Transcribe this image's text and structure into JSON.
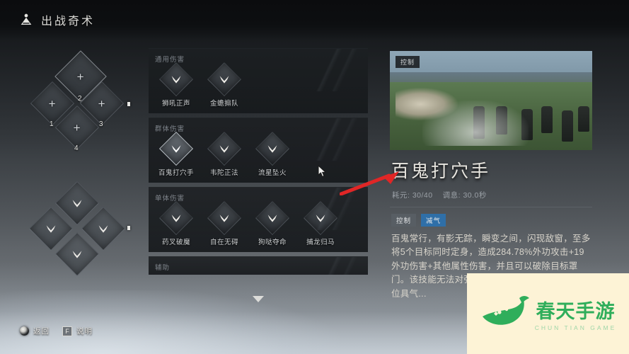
{
  "header": {
    "icon": "meditate-icon",
    "title": "出战奇术"
  },
  "equip": {
    "clusters": [
      {
        "name": "empty-slots",
        "slots": [
          {
            "icon": "plus-icon",
            "num": "2",
            "state": "empty",
            "selected": true
          },
          {
            "icon": "plus-icon",
            "num": "1",
            "state": "empty",
            "selected": false
          },
          {
            "icon": "plus-icon",
            "num": "3",
            "state": "empty",
            "selected": false
          },
          {
            "icon": "plus-icon",
            "num": "4",
            "state": "empty",
            "selected": false
          }
        ]
      },
      {
        "name": "equipped-slots",
        "slots": [
          {
            "icon": "fist-icon",
            "num": "",
            "state": "filled",
            "selected": false
          },
          {
            "icon": "fist-icon",
            "num": "",
            "state": "filled",
            "selected": false
          },
          {
            "icon": "fist-icon",
            "num": "",
            "state": "filled",
            "selected": false
          },
          {
            "icon": "fist-icon",
            "num": "",
            "state": "filled",
            "selected": false
          }
        ]
      }
    ]
  },
  "list": {
    "categories": [
      {
        "title": "通用伤害",
        "items": [
          {
            "label": "狮吼正声",
            "icon": "fist-icon",
            "selected": false
          },
          {
            "label": "金蟾搧队",
            "icon": "fist-icon",
            "selected": false
          }
        ]
      },
      {
        "title": "群体伤害",
        "items": [
          {
            "label": "百鬼打穴手",
            "icon": "fist-icon",
            "selected": true
          },
          {
            "label": "韦陀正法",
            "icon": "fist-icon",
            "selected": false
          },
          {
            "label": "流星坠火",
            "icon": "fist-icon",
            "selected": false
          }
        ]
      },
      {
        "title": "单体伤害",
        "items": [
          {
            "label": "药叉破魔",
            "icon": "fist-icon",
            "selected": false
          },
          {
            "label": "自在无碍",
            "icon": "fist-icon",
            "selected": false
          },
          {
            "label": "狗哒夺命",
            "icon": "fist-icon",
            "selected": false
          },
          {
            "label": "捕龙归马",
            "icon": "fist-icon",
            "selected": false
          }
        ]
      },
      {
        "title": "辅助",
        "items": []
      }
    ],
    "scroll_icon": "chevron-down-icon"
  },
  "detail": {
    "preview_badge": "控制",
    "title": "百鬼打穴手",
    "stats": [
      "耗元: 30/40",
      "调息: 30.0秒"
    ],
    "tags": [
      {
        "label": "控制",
        "color": "#585e64"
      },
      {
        "label": "减气",
        "color": "#2f6fa8"
      }
    ],
    "description": "百鬼常行，有影无踪，瞬变之间，闪现敌窗，至多将5个目标同时定身，造成284.78%外功攻击+19外功伤害+其他属性伤害，并且可以破除目标罩门。该技能无法对强敌单位造成罩门伤害，此类单位具气..."
  },
  "hotkeys": [
    {
      "key_icon": "circle-button-icon",
      "key": "",
      "label": "返回"
    },
    {
      "key_icon": "",
      "key": "F",
      "label": "说明"
    }
  ],
  "annotation": {
    "arrow_color": "#e02626",
    "cursor": "mouse-pointer"
  },
  "watermark": {
    "cn": "春天手游",
    "en": "CHUN TIAN GAME",
    "color": "#2fae5b",
    "bird_icon": "bird-logo-icon"
  }
}
